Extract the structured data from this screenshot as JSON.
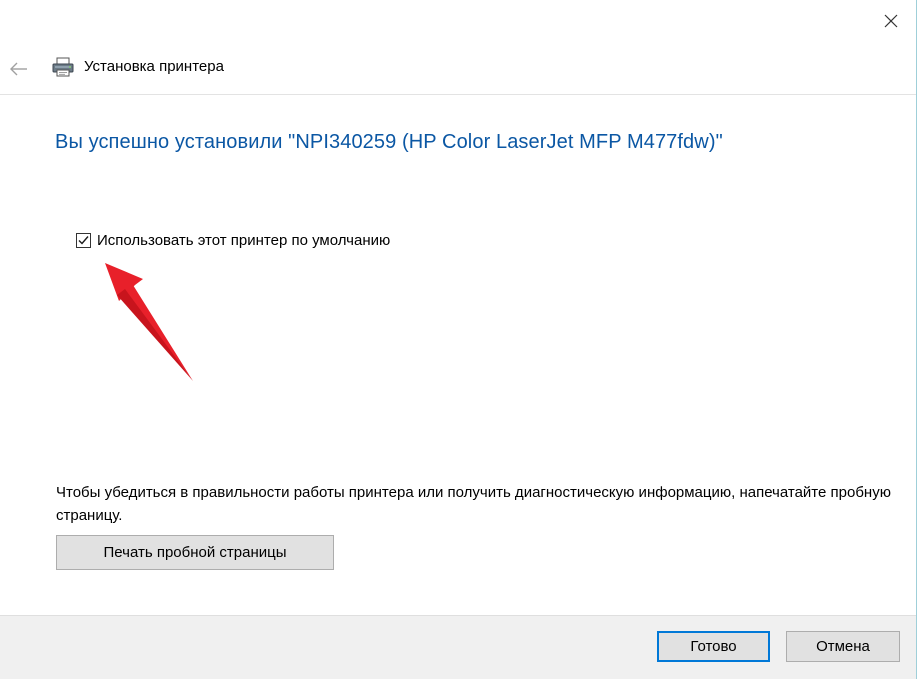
{
  "window": {
    "title": "Установка принтера"
  },
  "main": {
    "heading": "Вы успешно установили \"NPI340259 (HP Color LaserJet MFP M477fdw)\"",
    "default_printer_checkbox": {
      "label": "Использовать этот принтер по умолчанию",
      "checked": true
    },
    "info_text": "Чтобы убедиться в правильности работы принтера или получить диагностическую информацию, напечатайте пробную страницу.",
    "test_page_button": "Печать пробной страницы"
  },
  "footer": {
    "finish_button": "Готово",
    "cancel_button": "Отмена"
  },
  "colors": {
    "heading": "#0b57a4",
    "accent_border": "#0078d7",
    "annotation_arrow": "#e8202a",
    "footer_bg": "#f0f0f0"
  },
  "icons": {
    "close": "close-icon",
    "back": "back-arrow-icon",
    "printer": "printer-icon",
    "checkmark": "checkmark-icon"
  }
}
